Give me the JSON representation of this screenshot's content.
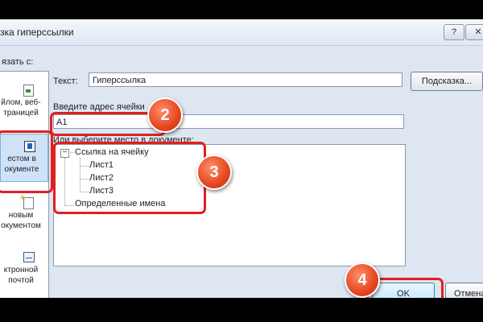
{
  "dialog": {
    "title": "зка гиперссылки"
  },
  "titlebar_buttons": {
    "help": "?",
    "close": "✕"
  },
  "link_to": {
    "label": "язать с:",
    "items": [
      {
        "label": "йлом, веб-\nтраницей",
        "icon": "file-web-icon"
      },
      {
        "label": "естом в\nокументе",
        "icon": "place-in-document-icon",
        "selected": true
      },
      {
        "label": "новым\nокументом",
        "icon": "new-document-icon"
      },
      {
        "label": "ктронной\nпочтой",
        "icon": "email-icon"
      }
    ]
  },
  "text_field": {
    "label": "Текст:",
    "value": "Гиперссылка"
  },
  "hint_button": "Подсказка...",
  "address": {
    "label": "Введите адрес ячейки",
    "value": "A1"
  },
  "place": {
    "label": "Или выберите место в документе:",
    "tree": {
      "expander": "−",
      "cell_ref": "Ссылка на ячейку",
      "sheets": [
        "Лист1",
        "Лист2",
        "Лист3"
      ],
      "defined_names": "Определенные имена"
    }
  },
  "annotations": {
    "badge2": "2",
    "badge3": "3",
    "badge4": "4",
    "highlight_color": "#e21e1e"
  },
  "buttons": {
    "ok": "OK",
    "cancel": "Отмена"
  }
}
